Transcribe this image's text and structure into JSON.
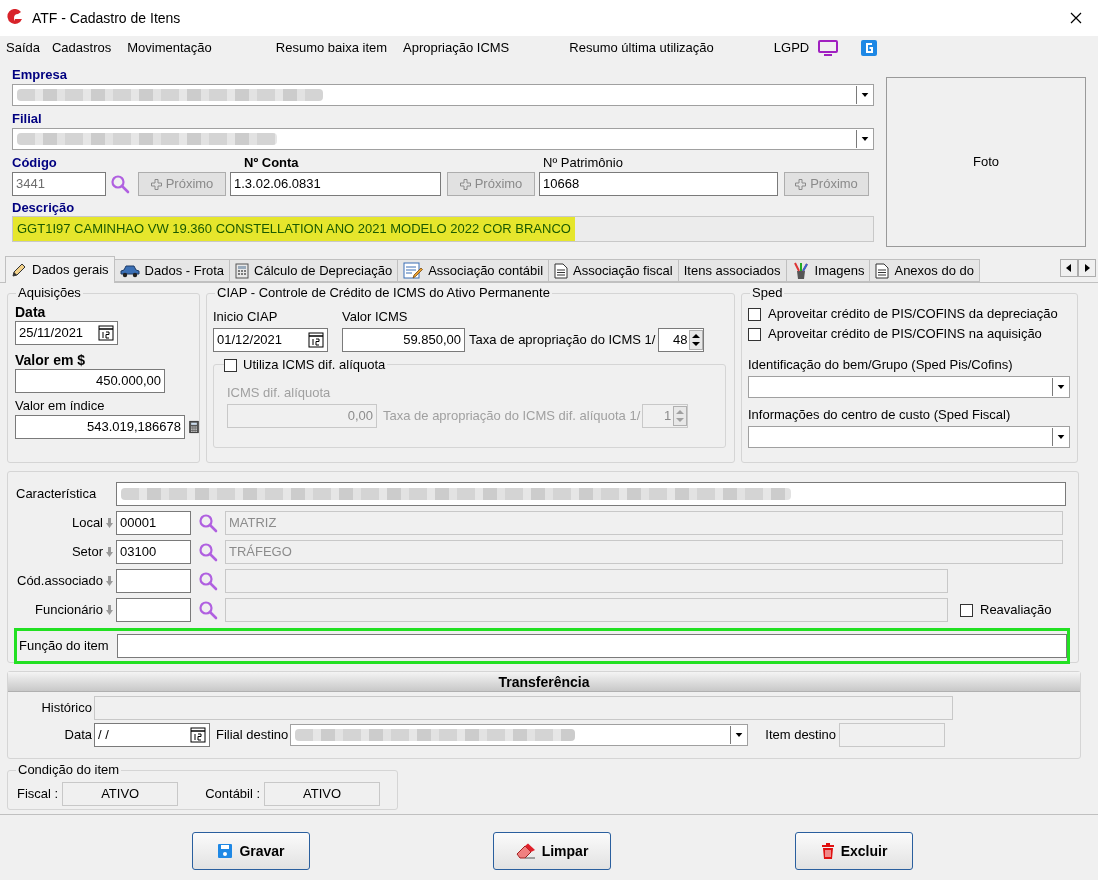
{
  "window": {
    "title": "ATF - Cadastro de Itens"
  },
  "menu": [
    {
      "label": "Saída"
    },
    {
      "label": "Cadastros"
    },
    {
      "label": "Movimentação"
    },
    {
      "label": "Resumo baixa item"
    },
    {
      "label": "Apropriação ICMS"
    },
    {
      "label": "Resumo última utilização"
    },
    {
      "label": "LGPD"
    }
  ],
  "header": {
    "empresa_label": "Empresa",
    "filial_label": "Filial",
    "codigo": {
      "label": "Código",
      "value": "3441",
      "next": "Próximo"
    },
    "conta": {
      "label": "Nº Conta",
      "value": "1.3.02.06.0831",
      "next": "Próximo"
    },
    "patrimonio": {
      "label": "Nº Patrimônio",
      "value": "10668",
      "next": "Próximo"
    },
    "descricao": {
      "label": "Descrição",
      "value": "GGT1I97 CAMINHAO VW 19.360 CONSTELLATION ANO 2021 MODELO 2022 COR BRANCO",
      "highlighted": true
    },
    "photo": {
      "label": "Foto"
    }
  },
  "tabs": [
    {
      "label": "Dados gerais",
      "kind": "pencil",
      "selected": true
    },
    {
      "label": "Dados - Frota",
      "kind": "car",
      "selected": false
    },
    {
      "label": "Cálculo de Depreciação",
      "kind": "calculator",
      "selected": false
    },
    {
      "label": "Associação contábil",
      "kind": "form",
      "selected": false
    },
    {
      "label": "Associação fiscal",
      "kind": "document",
      "selected": false
    },
    {
      "label": "Itens associados",
      "kind": "none",
      "selected": false
    },
    {
      "label": "Imagens",
      "kind": "brushes",
      "selected": false
    },
    {
      "label": "Anexos do do",
      "kind": "document",
      "selected": false
    }
  ],
  "aquisicoes": {
    "title": "Aquisições",
    "data": {
      "label": "Data",
      "value": "25/11/2021"
    },
    "valor": {
      "label": "Valor em $",
      "value": "450.000,00"
    },
    "valor_indice": {
      "label": "Valor em índice",
      "value": "543.019,186678"
    }
  },
  "ciap": {
    "title": "CIAP - Controle de Crédito de ICMS do Ativo Permanente",
    "inicio": {
      "label": "Inicio CIAP",
      "value": "01/12/2021"
    },
    "valor_icms": {
      "label": "Valor ICMS",
      "value": "59.850,00"
    },
    "taxa": {
      "label": "Taxa de apropriação do ICMS 1/",
      "value": "48"
    },
    "dif_aliquota": {
      "label": "Utiliza ICMS dif. alíquota",
      "checked": false,
      "field_label": "ICMS dif. alíquota",
      "value": "0,00",
      "taxa_label": "Taxa de apropriação do ICMS dif. alíquota 1/",
      "taxa_value": "1"
    }
  },
  "sped": {
    "title": "Sped",
    "checks": [
      {
        "label": "Aproveitar crédito de PIS/COFINS da depreciação",
        "checked": false
      },
      {
        "label": "Aproveitar crédito de PIS/COFINS na aquisição",
        "checked": false
      }
    ],
    "identificacao_label": "Identificação do bem/Grupo (Sped Pis/Cofins)",
    "centro_custo_label": "Informações do centro de custo (Sped Fiscal)"
  },
  "detalhes": {
    "caracteristica_label": "Característica",
    "lookups": [
      {
        "label": "Local",
        "code": "00001",
        "name": "MATRIZ"
      },
      {
        "label": "Setor",
        "code": "03100",
        "name": "TRÁFEGO"
      },
      {
        "label": "Cód.associado"
      },
      {
        "label": "Funcionário"
      }
    ],
    "reavaliacao": {
      "label": "Reavaliação",
      "checked": false
    },
    "funcao": {
      "label": "Função do item",
      "highlighted": true
    }
  },
  "transferencia": {
    "title": "Transferência",
    "historico_label": "Histórico",
    "data": {
      "label": "Data",
      "value": "/ /"
    },
    "filial_destino_label": "Filial destino",
    "item_destino_label": "Item destino"
  },
  "condicao": {
    "title": "Condição do item",
    "fiscal": {
      "label": "Fiscal :",
      "value": "ATIVO"
    },
    "contabil": {
      "label": "Contábil :",
      "value": "ATIVO"
    }
  },
  "buttons": [
    {
      "label": "Gravar",
      "kind": "save"
    },
    {
      "label": "Limpar",
      "kind": "clear"
    },
    {
      "label": "Excluir",
      "kind": "delete"
    }
  ]
}
